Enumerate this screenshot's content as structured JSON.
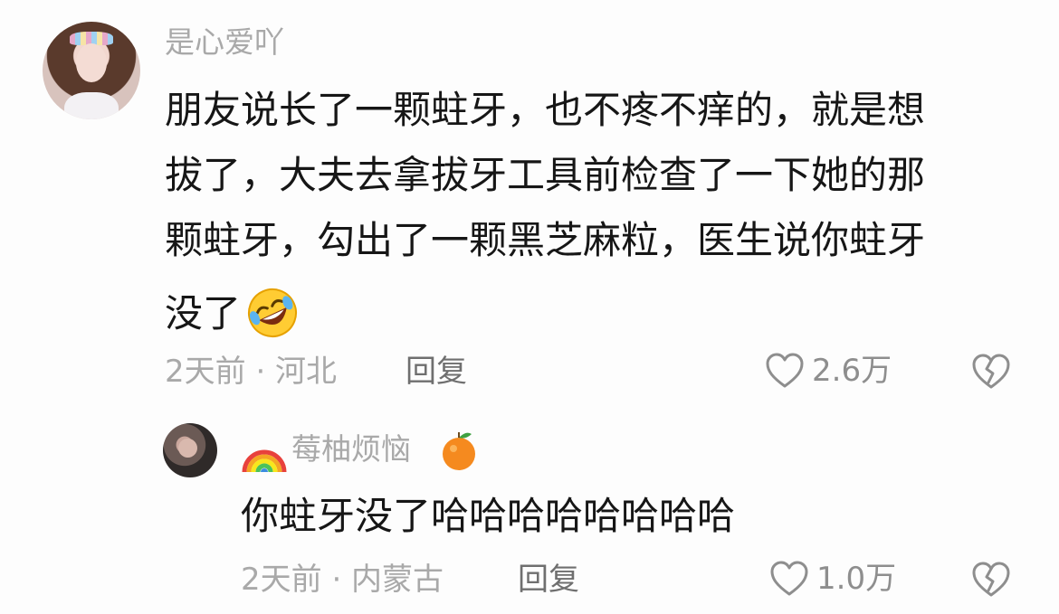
{
  "comment": {
    "username": "是心爱吖",
    "lines": [
      "朋友说长了一颗蛀牙，也不疼不痒的，就是想",
      "拔了，大夫去拿拔牙工具前检查了一下她的那",
      "颗蛀牙，勾出了一颗黑芝麻粒，医生说你蛀牙",
      "没了"
    ],
    "emoji": "rolling-on-floor-laughing-emoji",
    "meta": "2天前 · 河北",
    "reply_label": "回复",
    "like_count": "2.6万"
  },
  "reply": {
    "username": "莓柚烦恼",
    "name_prefix_icon": "rainbow-icon",
    "name_suffix_icon": "tangerine-icon",
    "text": "你蛀牙没了哈哈哈哈哈哈哈哈",
    "meta": "2天前 · 内蒙古",
    "reply_label": "回复",
    "like_count": "1.0万"
  },
  "colors": {
    "primary_text": "#161616",
    "secondary_text": "#a9a9a9",
    "icon_gray": "#8e8e8e",
    "background": "#fdfdfd"
  }
}
